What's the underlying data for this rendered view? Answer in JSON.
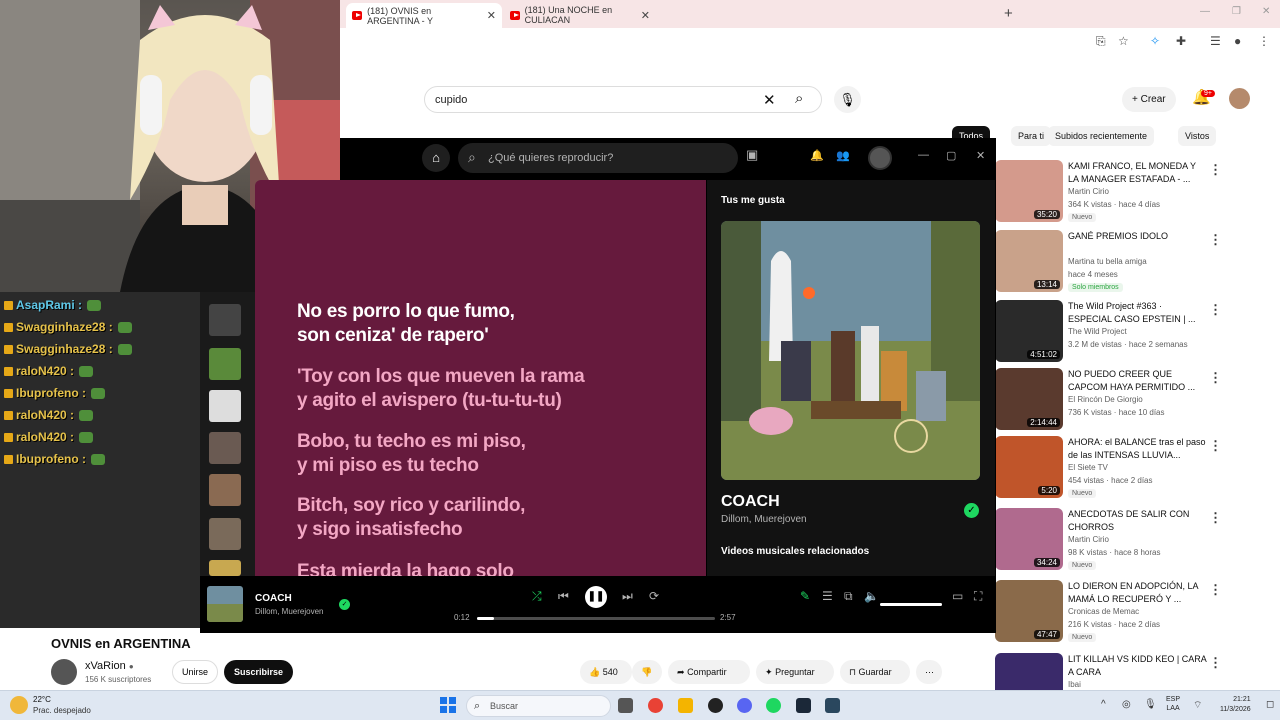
{
  "browser": {
    "tabs": [
      {
        "label": "(181) OVNIS en ARGENTINA - Y"
      },
      {
        "label": "(181) Una NOCHE en CULIACAN"
      }
    ],
    "new_tab": "+",
    "window_controls": [
      "—",
      "❐",
      "✕"
    ]
  },
  "youtube": {
    "search_value": "cupido",
    "create_label": "Crear",
    "notifications": "9+",
    "chips": [
      "Todos",
      "Para ti",
      "Subidos recientemente",
      "Vistos"
    ],
    "recommendations": [
      {
        "title": "KAMI FRANCO, EL MONEDA Y LA MANAGER ESTAFADA - ...",
        "channel": "Martin Cirio",
        "meta": "364 K vistas · hace 4 días",
        "badge": "Nuevo",
        "duration": "35:20",
        "color": "#d49a8c"
      },
      {
        "title": "GANÉ PREMIOS IDOLO",
        "channel": "Martina tu bella amiga",
        "meta": "hace 4 meses",
        "badge": "Solo miembros",
        "duration": "13:14",
        "color": "#c9a28a"
      },
      {
        "title": "The Wild Project #363 · ESPECIAL CASO EPSTEIN | ...",
        "channel": "The Wild Project",
        "meta": "3.2 M de vistas · hace 2 semanas",
        "badge": "",
        "duration": "4:51:02",
        "color": "#2a2a2a"
      },
      {
        "title": "NO PUEDO CREER QUE CAPCOM HAYA PERMITIDO ...",
        "channel": "El Rincón De Giorgio",
        "meta": "736 K vistas · hace 10 días",
        "badge": "",
        "duration": "2:14:44",
        "color": "#5a3a2e"
      },
      {
        "title": "AHORA: el BALANCE tras el paso de las INTENSAS LLUVIA...",
        "channel": "El Siete TV",
        "meta": "454 vistas · hace 2 días",
        "badge": "Nuevo",
        "duration": "5:20",
        "color": "#c0552a"
      },
      {
        "title": "ANECDOTAS DE SALIR CON CHORROS",
        "channel": "Martin Cirio",
        "meta": "98 K vistas · hace 8 horas",
        "badge": "Nuevo",
        "duration": "34:24",
        "color": "#b06a8e"
      },
      {
        "title": "LO DIERON EN ADOPCIÓN, LA MAMÁ LO RECUPERÓ Y ...",
        "channel": "Cronicas de Memac",
        "meta": "216 K vistas · hace 2 días",
        "badge": "Nuevo",
        "duration": "47:47",
        "color": "#8a6a4a"
      },
      {
        "title": "LIT KILLAH VS KIDD KEO | CARA A CARA",
        "channel": "Ibai",
        "meta": "",
        "badge": "",
        "duration": "",
        "color": "#3a2a6a"
      }
    ],
    "video": {
      "title": "OVNIS en ARGENTINA",
      "channel": "xVaRion",
      "subscribers": "156 K suscriptores",
      "join": "Unirse",
      "subscribe": "Suscribirse",
      "likes": "540",
      "share": "Compartir",
      "ask": "Preguntar",
      "save": "Guardar"
    }
  },
  "chat": [
    {
      "user": "AsapRami :",
      "color": "#5fc8e8"
    },
    {
      "user": "Swagginhaze28 :",
      "color": "#e6c24a"
    },
    {
      "user": "Swagginhaze28 :",
      "color": "#e6c24a"
    },
    {
      "user": "raloN420 :",
      "color": "#e6c24a"
    },
    {
      "user": "Ibuprofeno :",
      "color": "#e6c24a"
    },
    {
      "user": "raloN420 :",
      "color": "#e6c24a"
    },
    {
      "user": "raloN420 :",
      "color": "#e6c24a"
    },
    {
      "user": "Ibuprofeno :",
      "color": "#e6c24a"
    }
  ],
  "spotify": {
    "search_placeholder": "¿Qué quieres reproducir?",
    "lyrics": [
      {
        "l1": "No es porro lo que fumo,",
        "l2": "son ceniza' de rapero'",
        "color": "#ffffff"
      },
      {
        "l1": "'Toy con los que mueven la rama",
        "l2": "y agito el avispero (tu-tu-tu-tu)",
        "color": "#f3a7c4"
      },
      {
        "l1": "Bobo, tu techo es mi piso,",
        "l2": "y mi piso es tu techo",
        "color": "#f3a7c4"
      },
      {
        "l1": "Bitch, soy rico y carilindo,",
        "l2": "y sigo insatisfecho",
        "color": "#f3a7c4"
      },
      {
        "l1": "Esta mierda la hago solo",
        "l2": "",
        "color": "#f3a7c4"
      }
    ],
    "panel": {
      "heading": "Tus me gusta",
      "song": "COACH",
      "artists": "Dillom, Muerejoven",
      "related": "Videos musicales relacionados"
    },
    "player": {
      "song": "COACH",
      "artists": "Dillom, Muerejoven",
      "elapsed": "0:12",
      "total": "2:57",
      "progress": 0.07,
      "volume": 1.0
    }
  },
  "taskbar": {
    "temp": "22°C",
    "weather": "Prac. despejado",
    "search": "Buscar",
    "lang1": "ESP",
    "lang2": "LAA",
    "time": "21:21",
    "date": "11/3/2026"
  }
}
